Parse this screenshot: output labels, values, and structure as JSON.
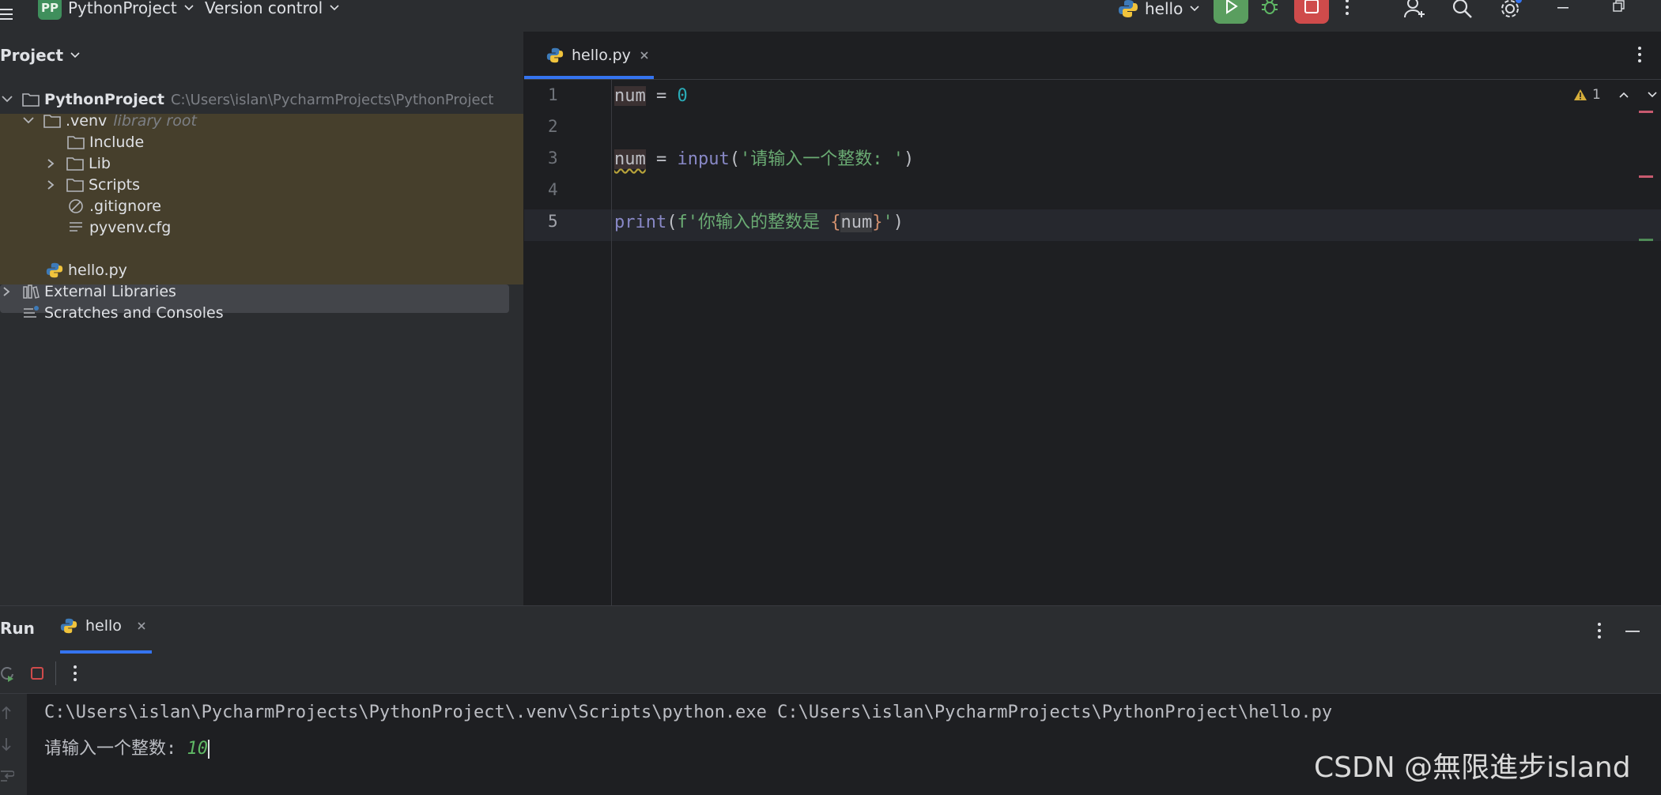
{
  "titlebar": {
    "project_badge": "PP",
    "project_name": "PythonProject",
    "version_control": "Version control",
    "run_config": "hello",
    "icons": [
      "menu-icon",
      "chevron-down-icon",
      "python-icon",
      "run-icon",
      "debug-icon",
      "stop-icon",
      "more-icon",
      "add-user-icon",
      "search-icon",
      "settings-icon",
      "minimize-icon",
      "restore-icon"
    ]
  },
  "project_panel": {
    "title": "Project",
    "tree": [
      {
        "label": "PythonProject",
        "path": "C:\\Users\\islan\\PycharmProjects\\PythonProject"
      },
      {
        "label": ".venv",
        "note": "library root"
      },
      {
        "label": "Include"
      },
      {
        "label": "Lib"
      },
      {
        "label": "Scripts"
      },
      {
        "label": ".gitignore"
      },
      {
        "label": "pyvenv.cfg"
      },
      {
        "label": "hello.py"
      },
      {
        "label": "External Libraries"
      },
      {
        "label": "Scratches and Consoles"
      }
    ]
  },
  "editor": {
    "tab_label": "hello.py",
    "warning_count": "1",
    "line_numbers": [
      "1",
      "2",
      "3",
      "4",
      "5"
    ],
    "code": {
      "l1_var": "num",
      "l1_op": " = ",
      "l1_num": "0",
      "l3_var": "num",
      "l3_op": " = ",
      "l3_fn": "input",
      "l3_paren_open": "(",
      "l3_str": "'请输入一个整数: '",
      "l3_paren_close": ")",
      "l5_fn": "print",
      "l5_paren_open": "(",
      "l5_str_prefix": "f'你输入的整数是 ",
      "l5_brace_open": "{",
      "l5_var": "num",
      "l5_brace_close": "}",
      "l5_str_end": "'",
      "l5_paren_close": ")"
    },
    "colors": {
      "number": "#2aacb8",
      "string": "#6aab73",
      "builtin": "#8888c6",
      "brace": "#cf8e6d"
    }
  },
  "run_panel": {
    "title": "Run",
    "tab_label": "hello",
    "console": {
      "command": "C:\\Users\\islan\\PycharmProjects\\PythonProject\\.venv\\Scripts\\python.exe C:\\Users\\islan\\PycharmProjects\\PythonProject\\hello.py",
      "prompt": "请输入一个整数: ",
      "user_input": "10"
    }
  },
  "watermark": "CSDN @無限進步island"
}
